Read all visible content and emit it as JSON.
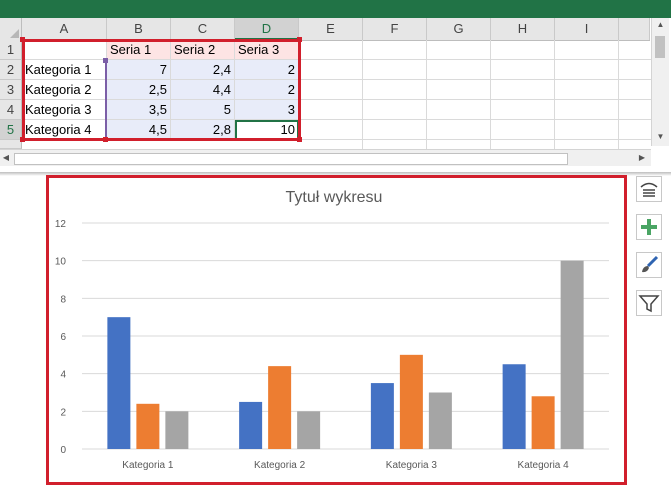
{
  "columns": [
    "A",
    "B",
    "C",
    "D",
    "E",
    "F",
    "G",
    "H",
    "I"
  ],
  "rows": [
    "1",
    "2",
    "3",
    "4",
    "5"
  ],
  "table": {
    "header": [
      "",
      "Seria 1",
      "Seria 2",
      "Seria 3"
    ],
    "data": [
      [
        "Kategoria 1",
        "7",
        "2,4",
        "2"
      ],
      [
        "Kategoria 2",
        "2,5",
        "4,4",
        "2"
      ],
      [
        "Kategoria 3",
        "3,5",
        "5",
        "3"
      ],
      [
        "Kategoria 4",
        "4,5",
        "2,8",
        "10"
      ]
    ]
  },
  "selected_column": "D",
  "selected_row": "5",
  "active_cell": "D5",
  "colors": {
    "ribbon": "#217346",
    "highlight_border": "#d11f2c",
    "series": [
      "#4472c4",
      "#ed7d31",
      "#a5a5a5"
    ]
  },
  "side_tools": [
    "chart-elements-icon",
    "chart-styles-icon",
    "chart-filters-icon"
  ],
  "chart_data": {
    "type": "bar",
    "title": "Tytuł wykresu",
    "categories": [
      "Kategoria 1",
      "Kategoria 2",
      "Kategoria 3",
      "Kategoria 4"
    ],
    "series": [
      {
        "values": [
          7,
          2.5,
          3.5,
          4.5
        ]
      },
      {
        "values": [
          2.4,
          4.4,
          5,
          2.8
        ]
      },
      {
        "values": [
          2,
          2,
          3,
          10
        ]
      }
    ],
    "yticks": [
      "0",
      "2",
      "4",
      "6",
      "8",
      "10",
      "12"
    ],
    "ylim": [
      0,
      12
    ],
    "grid": true,
    "legend": "none"
  }
}
